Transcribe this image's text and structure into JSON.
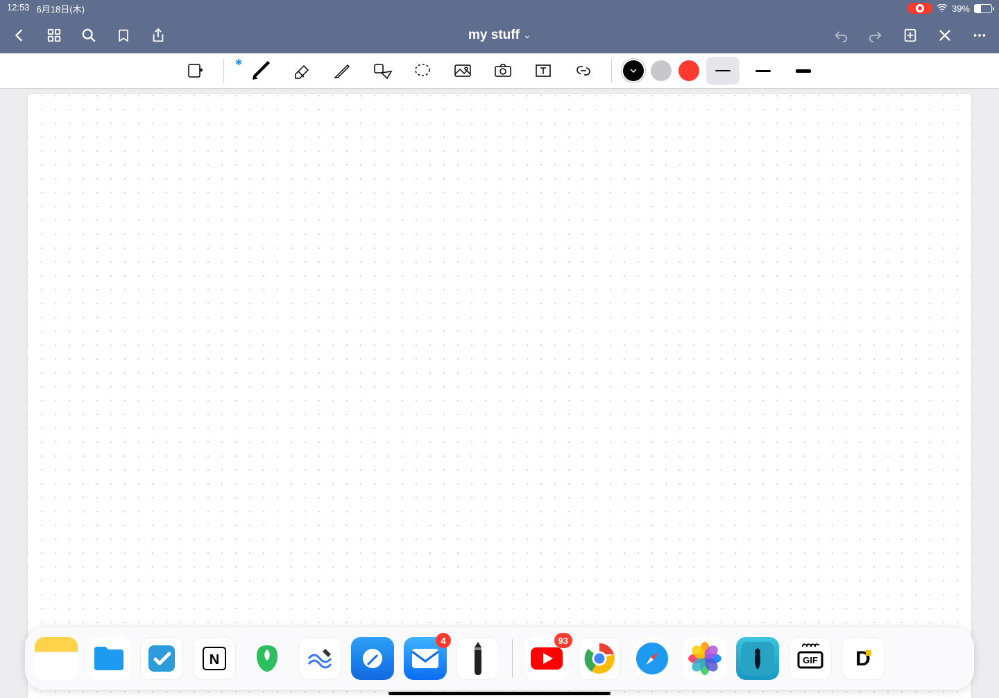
{
  "status": {
    "time": "12:53",
    "date": "6月18日(木)",
    "battery_pct": "39%",
    "battery_fill": 39
  },
  "nav": {
    "title": "my stuff"
  },
  "toolbar": {
    "colors": {
      "black": "#000000",
      "gray": "#c7c7cc",
      "red": "#ff3b30"
    }
  },
  "dock": {
    "mail_badge": "4",
    "youtube_badge": "93",
    "gif_label": "GIF",
    "d_label": "D",
    "notion_label": "N"
  }
}
